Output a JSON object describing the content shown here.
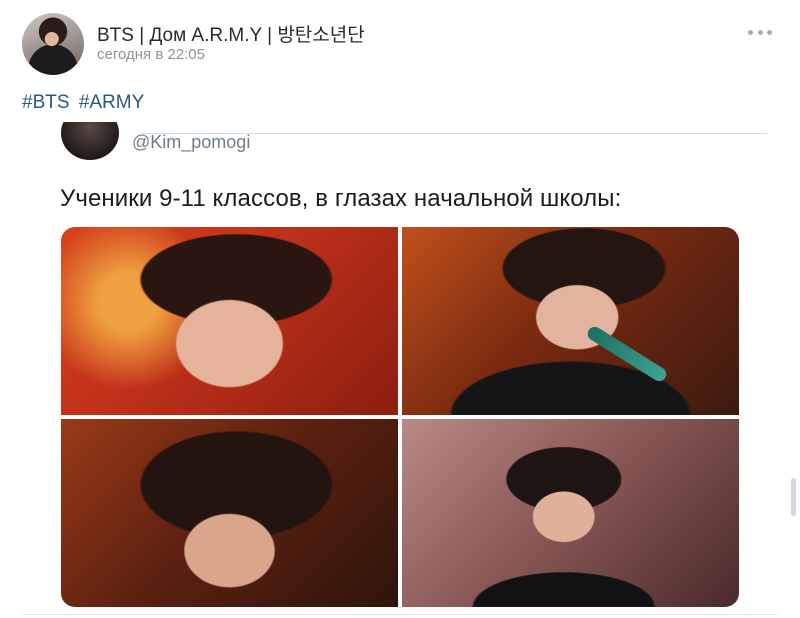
{
  "post": {
    "author_name": "BTS | Дом A.R.M.Y | 방탄소년단",
    "timestamp": "сегодня в 22:05",
    "more_icon": "more-horizontal-icon",
    "hashtags": [
      "#BTS",
      "#ARMY"
    ],
    "attachment": {
      "tweet_handle": "@Kim_pomogi",
      "tweet_text": "Ученики 9-11 классов, в глазах начальной школы:",
      "photo_count": 4
    }
  },
  "colors": {
    "link": "#2a5885",
    "meta_text": "#939393",
    "title_text": "#2a2a2a"
  }
}
